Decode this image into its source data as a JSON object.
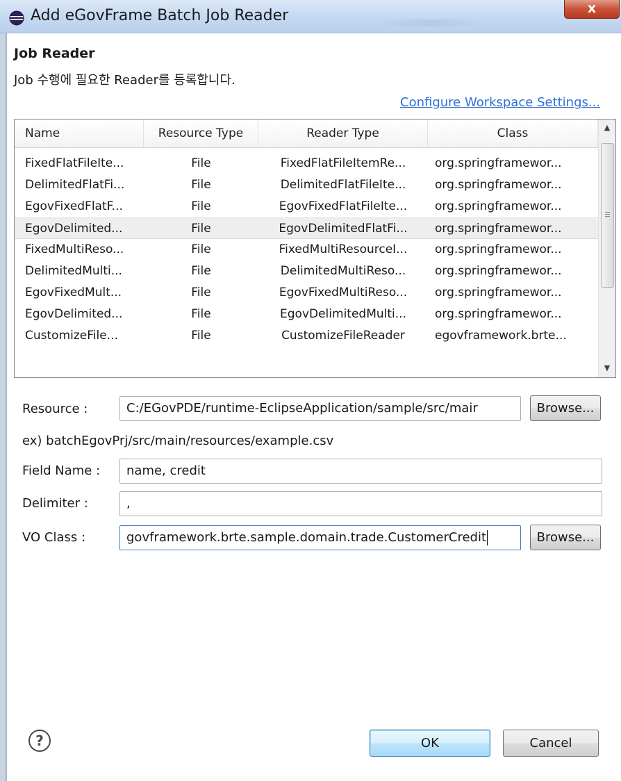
{
  "window": {
    "title": "Add eGovFrame Batch Job Reader",
    "close_label": "x"
  },
  "header": {
    "heading": "Job Reader",
    "description": "Job 수행에 필요한 Reader를 등록합니다.",
    "link": "Configure Workspace Settings..."
  },
  "table": {
    "columns": [
      "Name",
      "Resource Type",
      "Reader Type",
      "Class"
    ],
    "rows": [
      {
        "name": "FixedFlatFileIte...",
        "resource_type": "File",
        "reader_type": "FixedFlatFileItemRe...",
        "class": "org.springframewor..."
      },
      {
        "name": "DelimitedFlatFi...",
        "resource_type": "File",
        "reader_type": "DelimitedFlatFileIte...",
        "class": "org.springframewor..."
      },
      {
        "name": "EgovFixedFlatF...",
        "resource_type": "File",
        "reader_type": "EgovFixedFlatFileIte...",
        "class": "org.springframewor..."
      },
      {
        "name": "EgovDelimited...",
        "resource_type": "File",
        "reader_type": "EgovDelimitedFlatFi...",
        "class": "org.springframewor..."
      },
      {
        "name": "FixedMultiReso...",
        "resource_type": "File",
        "reader_type": "FixedMultiResourceI...",
        "class": "org.springframewor..."
      },
      {
        "name": "DelimitedMulti...",
        "resource_type": "File",
        "reader_type": "DelimitedMultiReso...",
        "class": "org.springframewor..."
      },
      {
        "name": "EgovFixedMult...",
        "resource_type": "File",
        "reader_type": "EgovFixedMultiReso...",
        "class": "org.springframewor..."
      },
      {
        "name": "EgovDelimited...",
        "resource_type": "File",
        "reader_type": "EgovDelimitedMulti...",
        "class": "org.springframewor..."
      },
      {
        "name": "CustomizeFile...",
        "resource_type": "File",
        "reader_type": "CustomizeFileReader",
        "class": "egovframework.brte..."
      }
    ],
    "selected_row_index": 3
  },
  "form": {
    "resource_label": "Resource :",
    "resource_value": "C:/EGovPDE/runtime-EclipseApplication/sample/src/mair",
    "browse_label": "Browse...",
    "example_text": "ex) batchEgovPrj/src/main/resources/example.csv",
    "field_name_label": "Field Name :",
    "field_name_value": "name, credit",
    "delimiter_label": "Delimiter :",
    "delimiter_value": ",",
    "vo_class_label": "VO Class :",
    "vo_class_value": "govframework.brte.sample.domain.trade.CustomerCredit"
  },
  "footer": {
    "help_label": "?",
    "ok_label": "OK",
    "cancel_label": "Cancel"
  }
}
